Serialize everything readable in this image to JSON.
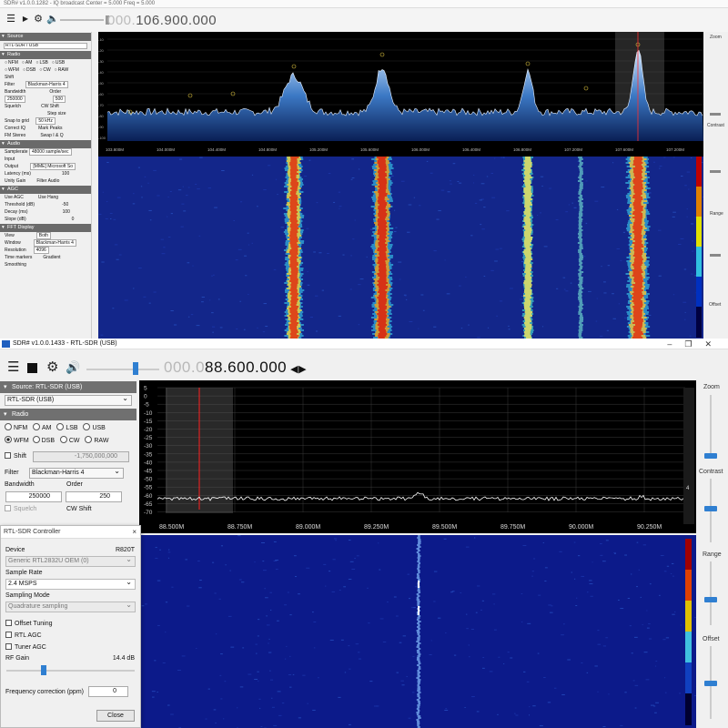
{
  "top": {
    "title": "SDR# v1.0.0.1282 - IQ broadcast  Center = 5.000  Freq = 5.000",
    "freq": {
      "dim": "000.",
      "main": "106.900.000"
    },
    "sidebar": {
      "source_header": "Source",
      "source_value": "RTL-SDR / USB",
      "radio_header": "Radio",
      "modes": [
        "NFM",
        "AM",
        "LSB",
        "USB",
        "WFM",
        "DSB",
        "CW",
        "RAW"
      ],
      "shift_label": "Shift",
      "filter_label": "Filter",
      "filter_value": "Blackman-Harris 4",
      "bandwidth_label": "Bandwidth",
      "order_label": "Order",
      "bandwidth_value": "250000",
      "order_value": "500",
      "squelch_label": "Squelch",
      "cw_shift_label": "CW Shift",
      "step_size_label": "Step size",
      "snap_label": "Snap to grid",
      "snap_value": "50 kHz",
      "correct_iq": "Correct IQ",
      "mark_peaks": "Mark Peaks",
      "fm_stereo": "FM Stereo",
      "swap_iq": "Swap I & Q",
      "audio_header": "Audio",
      "samplerate_label": "Samplerate",
      "samplerate_value": "48000 sample/sec",
      "input_label": "Input",
      "output_label": "Output",
      "output_value": "[MME] Microsoft So",
      "latency_label": "Latency (ms)",
      "latency_value": "100",
      "unity_gain": "Unity Gain",
      "filter_audio": "Filter Audio",
      "agc_header": "AGC",
      "use_agc": "Use AGC",
      "use_hang": "Use Hang",
      "threshold_label": "Threshold (dB)",
      "threshold_value": "-50",
      "decay_label": "Decay (ms)",
      "decay_value": "100",
      "slope_label": "Slope (dB)",
      "slope_value": "0",
      "fft_header": "FFT Display",
      "view_label": "View",
      "view_value": "Both",
      "window_label": "Window",
      "window_value": "Blackman-Harris 4",
      "resolution_label": "Resolution",
      "resolution_value": "4096",
      "time_markers": "Time markers",
      "gradient_label": "Gradient",
      "smoothing_label": "Smoothing"
    },
    "spectrum": {
      "freq_labels": [
        "103.800M",
        "104.000M",
        "104.400M",
        "104.800M",
        "105.200M",
        "105.600M",
        "106.000M",
        "106.400M",
        "106.800M",
        "107.200M",
        "107.600M",
        "107.200M"
      ],
      "db_labels": [
        "-10",
        "-20",
        "-30",
        "-40",
        "-50",
        "-60",
        "-70",
        "-80",
        "-90",
        "-100"
      ]
    },
    "right": {
      "zoom": "Zoom",
      "contrast": "Contrast",
      "range": "Range",
      "offset": "Offset"
    }
  },
  "bottom": {
    "title": "SDR# v1.0.0.1433 - RTL-SDR (USB)",
    "freq": {
      "dim": "000.0",
      "main": "88.600.000"
    },
    "sidebar": {
      "source_header": "Source: RTL-SDR (USB)",
      "source_value": "RTL-SDR (USB)",
      "radio_header": "Radio",
      "modes": [
        "NFM",
        "AM",
        "LSB",
        "USB",
        "WFM",
        "DSB",
        "CW",
        "RAW"
      ],
      "selected_mode": "WFM",
      "shift_label": "Shift",
      "shift_value": "-1,750,000,000",
      "filter_label": "Filter",
      "filter_value": "Blackman-Harris 4",
      "bandwidth_label": "Bandwidth",
      "order_label": "Order",
      "bandwidth_value": "250000",
      "order_value": "250",
      "squelch_label": "Squelch",
      "cw_shift_label": "CW Shift"
    },
    "spectrum": {
      "db_labels": [
        "5",
        "0",
        "-5",
        "-10",
        "-15",
        "-20",
        "-25",
        "-30",
        "-35",
        "-40",
        "-45",
        "-50",
        "-55",
        "-60",
        "-65",
        "-70"
      ],
      "freq_labels": [
        "88.500M",
        "88.750M",
        "89.000M",
        "89.250M",
        "89.500M",
        "89.750M",
        "90.000M",
        "90.250M"
      ],
      "side_value": "4"
    },
    "right": {
      "zoom": "Zoom",
      "contrast": "Contrast",
      "range": "Range",
      "offset": "Offset"
    },
    "dialog": {
      "title": "RTL-SDR Controller",
      "close_x": "×",
      "device_label": "Device",
      "device_tuner": "R820T",
      "device_value": "Generic RTL2832U OEM (0)",
      "sample_rate_label": "Sample Rate",
      "sample_rate_value": "2.4 MSPS",
      "sampling_mode_label": "Sampling Mode",
      "sampling_mode_value": "Quadrature sampling",
      "offset_tuning": "Offset Tuning",
      "rtl_agc": "RTL AGC",
      "tuner_agc": "Tuner AGC",
      "rf_gain_label": "RF Gain",
      "rf_gain_value": "14.4 dB",
      "freq_corr_label": "Frequency correction (ppm)",
      "freq_corr_value": "0",
      "close_button": "Close"
    }
  },
  "colors": {
    "accent": "#2f7fd1",
    "spectrum_bg": "#000000",
    "waterfall_bg": "#0c1a8a",
    "trace": "#ffffff",
    "marker": "#ff2020"
  }
}
